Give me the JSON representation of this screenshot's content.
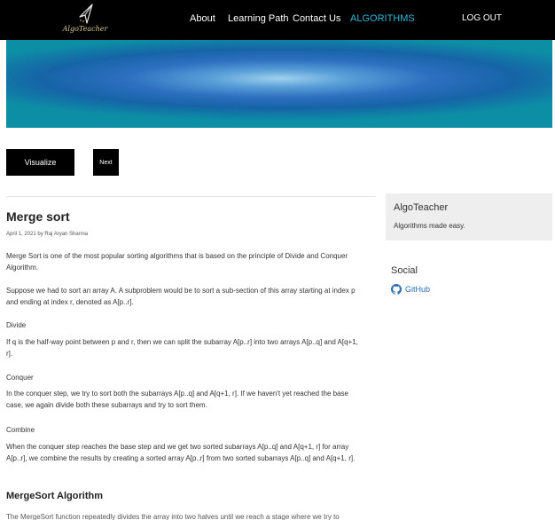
{
  "nav": {
    "logo_text": "AlgoTeacher",
    "links": [
      "About",
      "Learning Path",
      "Contact Us",
      "ALGORITHMS",
      "LOG OUT"
    ],
    "active_color": "#2fb8d6"
  },
  "controls": {
    "visualize_label": "Visualize",
    "next_label": "Next"
  },
  "post": {
    "title": "Merge sort",
    "meta": "April 1, 2021 by Raj Aryan Sharma",
    "intro": "Merge Sort is one of the most popular sorting algorithms that is based on the principle of Divide and Conquer Algorithm.",
    "suppose": "Suppose we had to sort an array A. A subproblem would be to sort a sub-section of this array starting at index p and ending at index r, denoted as A[p..r].",
    "divide_heading": "Divide",
    "divide_text": "If q is the half-way point between p and r, then we can split the subarray A[p..r] into two arrays A[p..q] and A[q+1, r].",
    "conquer_heading": "Conquer",
    "conquer_text": "In the conquer step, we try to sort both the subarrays A[p..q] and A[q+1, r]. If we haven't yet reached the base case, we again divide both these subarrays and try to sort them.",
    "combine_heading": "Combine",
    "combine_text": "When the conquer step reaches the base step and we get two sorted subarrays A[p..q] and A[q+1, r] for array A[p..r], we combine the results by creating a sorted array A[p..r] from two sorted subarrays A[p..q] and A[q+1, r].",
    "algo_heading": "MergeSort Algorithm",
    "algo_text": "The MergeSort function repeatedly divides the array into two halves until we reach a stage where we try to"
  },
  "sidebar": {
    "title": "AlgoTeacher",
    "subtitle": "Algorithms made easy.",
    "social_title": "Social",
    "github_label": "GitHub",
    "link_color": "#2c6fb5"
  }
}
